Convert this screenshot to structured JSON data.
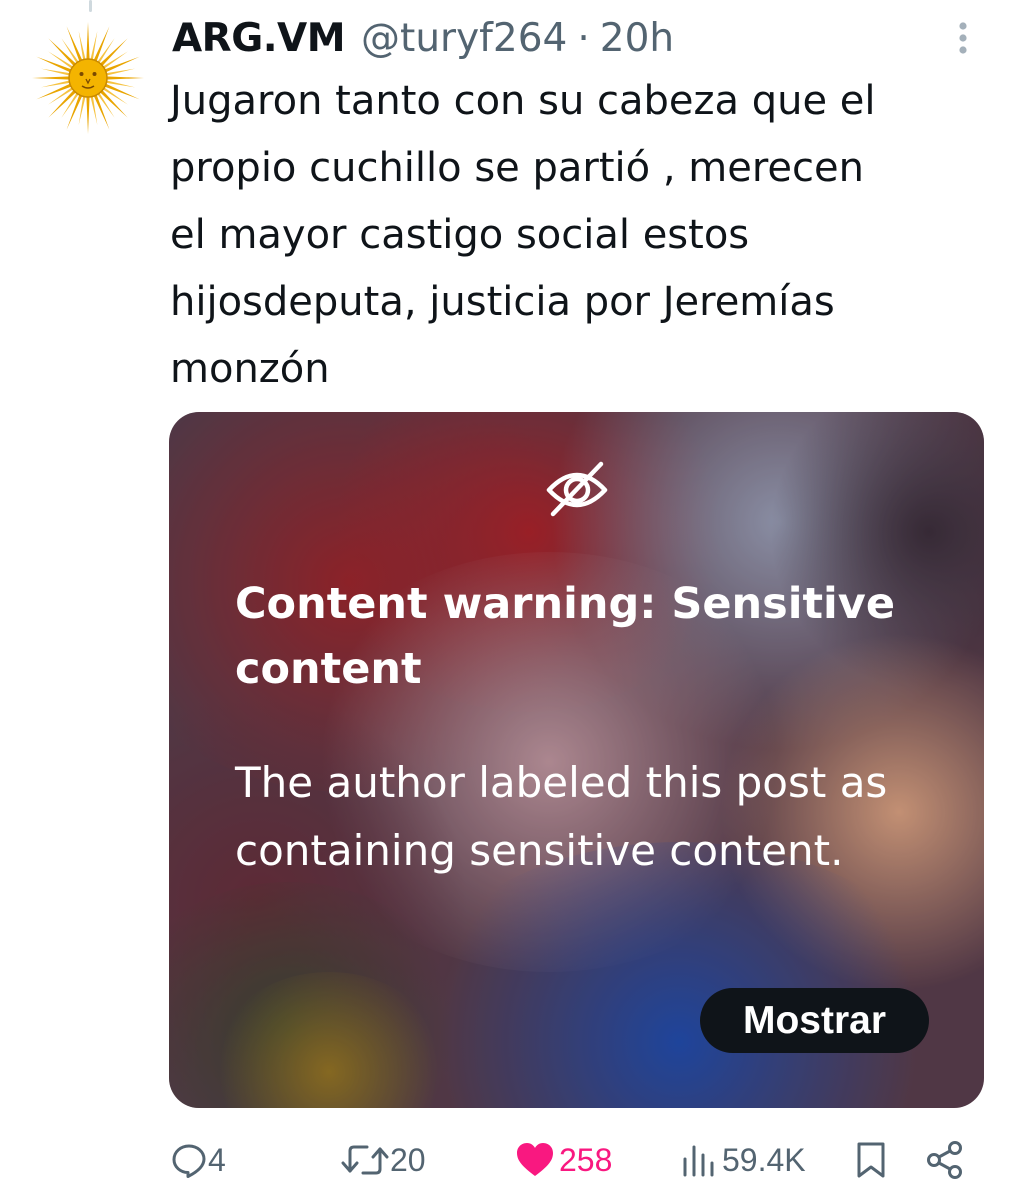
{
  "author": {
    "display_name": "ARG.VM",
    "handle": "@turyf264",
    "separator": "·",
    "time": "20h",
    "avatar_icon": "sol-de-mayo-icon"
  },
  "post": {
    "text": "Jugaron tanto con su cabeza que el\npropio cuchillo se partió , merecen\nel mayor castigo social estos\nhijosdeputa, justicia por Jeremías\nmonzón"
  },
  "media": {
    "warning_icon": "eye-slash-icon",
    "warning_title": "Content warning: Sensitive content",
    "warning_body": "The author labeled this post as containing sensitive content.",
    "show_label": "Mostrar"
  },
  "actions": {
    "replies": "4",
    "reposts": "20",
    "likes": "258",
    "views": "59.4K",
    "like_color": "#f91880",
    "muted_color": "#536471",
    "icons": [
      "reply-icon",
      "repost-icon",
      "heart-icon",
      "views-icon",
      "bookmark-icon",
      "share-icon"
    ]
  }
}
